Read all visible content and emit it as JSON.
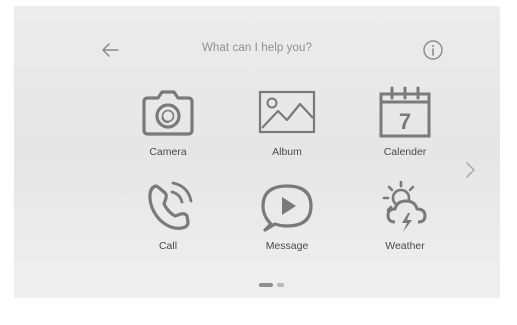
{
  "header": {
    "title": "What can I help you?"
  },
  "icons": {
    "back": "arrow-left-icon",
    "info": "info-circle-icon",
    "next": "chevron-right-icon"
  },
  "apps": [
    {
      "label": "Camera",
      "icon": "camera-icon"
    },
    {
      "label": "Album",
      "icon": "image-icon"
    },
    {
      "label": "Calender",
      "icon": "calendar-icon",
      "day": "7"
    },
    {
      "label": "Call",
      "icon": "phone-icon"
    },
    {
      "label": "Message",
      "icon": "message-play-icon"
    },
    {
      "label": "Weather",
      "icon": "weather-storm-icon"
    }
  ],
  "pager": {
    "current_page": 1,
    "total_pages": 2
  },
  "colors": {
    "icon_stroke": "#7a7a7a",
    "label_text": "#4a4a4a",
    "title_text": "#8f8f8f",
    "background": "#e8e8e8"
  }
}
